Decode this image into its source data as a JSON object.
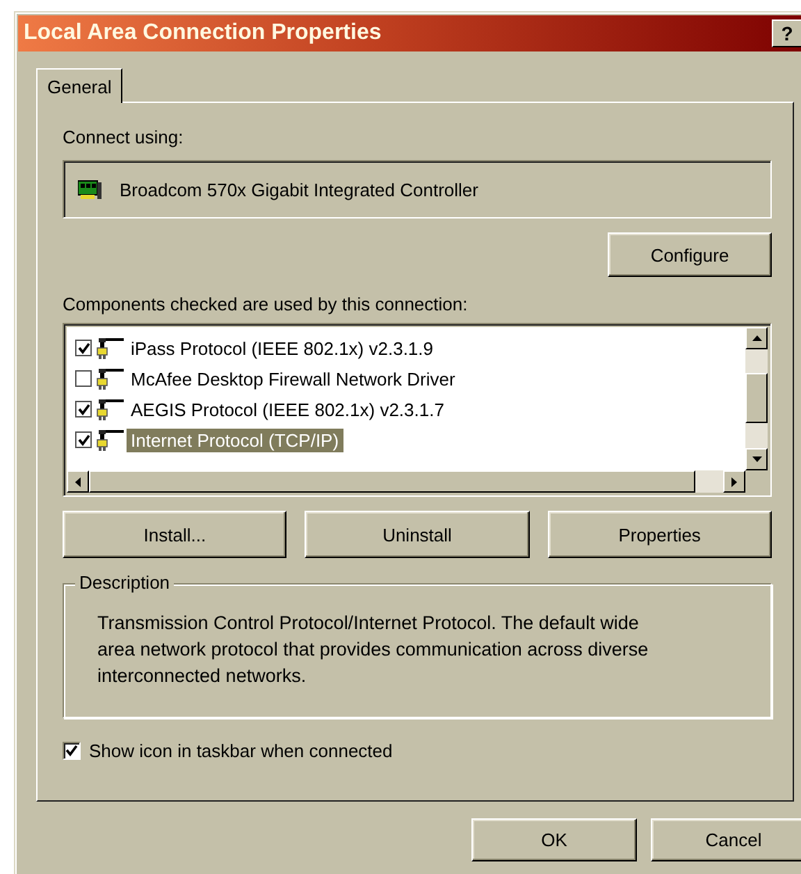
{
  "window": {
    "title": "Local Area Connection Properties",
    "help_button": "?"
  },
  "tabs": [
    {
      "label": "General",
      "selected": true
    }
  ],
  "connect_using": {
    "label": "Connect using:",
    "adapter": "Broadcom 570x Gigabit Integrated Controller",
    "configure_button": {
      "label": "Configure"
    }
  },
  "components": {
    "label": "Components checked are used by this connection:",
    "items": [
      {
        "label": "iPass Protocol (IEEE 802.1x) v2.3.1.9",
        "checked": true,
        "selected": false
      },
      {
        "label": "McAfee Desktop Firewall Network Driver",
        "checked": false,
        "selected": false
      },
      {
        "label": "AEGIS Protocol (IEEE 802.1x) v2.3.1.7",
        "checked": true,
        "selected": false
      },
      {
        "label": "Internet Protocol (TCP/IP)",
        "checked": true,
        "selected": true
      }
    ]
  },
  "component_buttons": [
    {
      "label": "Install..."
    },
    {
      "label": "Uninstall"
    },
    {
      "label": "Properties"
    }
  ],
  "description": {
    "title": "Description",
    "text": "Transmission Control Protocol/Internet Protocol. The default wide area network protocol that provides communication across diverse interconnected networks."
  },
  "show_icon": {
    "label": "Show icon in taskbar when connected",
    "checked": true
  },
  "dialog_buttons": [
    {
      "label": "OK"
    },
    {
      "label": "Cancel"
    }
  ]
}
